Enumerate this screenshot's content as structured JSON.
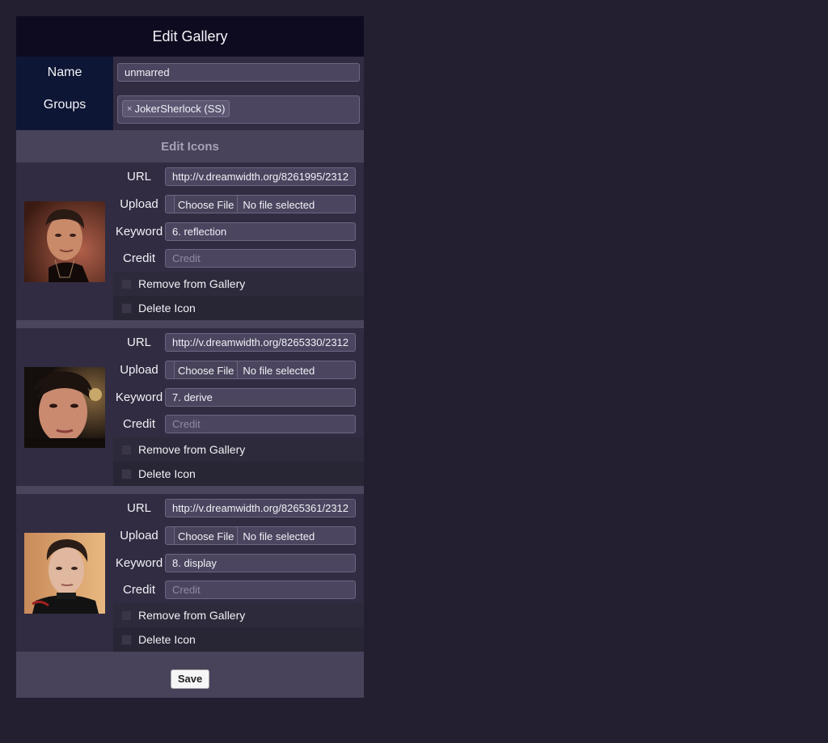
{
  "header": {
    "title": "Edit Gallery"
  },
  "gallery": {
    "name_label": "Name",
    "name_value": "unmarred",
    "groups_label": "Groups",
    "groups": [
      {
        "remove_symbol": "×",
        "label": "JokerSherlock (SS)"
      }
    ]
  },
  "icons_section": {
    "title": "Edit Icons"
  },
  "field_labels": {
    "url": "URL",
    "upload": "Upload",
    "keyword": "Keyword",
    "credit": "Credit",
    "remove_from_gallery": "Remove from Gallery",
    "delete_icon": "Delete Icon"
  },
  "upload_control": {
    "button": "Choose File",
    "status": "No file selected"
  },
  "icons": [
    {
      "url": "http://v.dreamwidth.org/8261995/2312",
      "keyword": "6. reflection",
      "credit_placeholder": "Credit",
      "remove_checked": false,
      "delete_checked": false
    },
    {
      "url": "http://v.dreamwidth.org/8265330/2312",
      "keyword": "7. derive",
      "credit_placeholder": "Credit",
      "remove_checked": false,
      "delete_checked": false
    },
    {
      "url": "http://v.dreamwidth.org/8265361/2312",
      "keyword": "8. display",
      "credit_placeholder": "Credit",
      "remove_checked": false,
      "delete_checked": false
    }
  ],
  "footer": {
    "save_label": "Save"
  },
  "colors": {
    "page_bg": "#231f31",
    "title_bg": "#0e0b20",
    "label_col_bg": "#0e1635",
    "section_bg": "#48425a",
    "field_bg": "#312c42"
  }
}
